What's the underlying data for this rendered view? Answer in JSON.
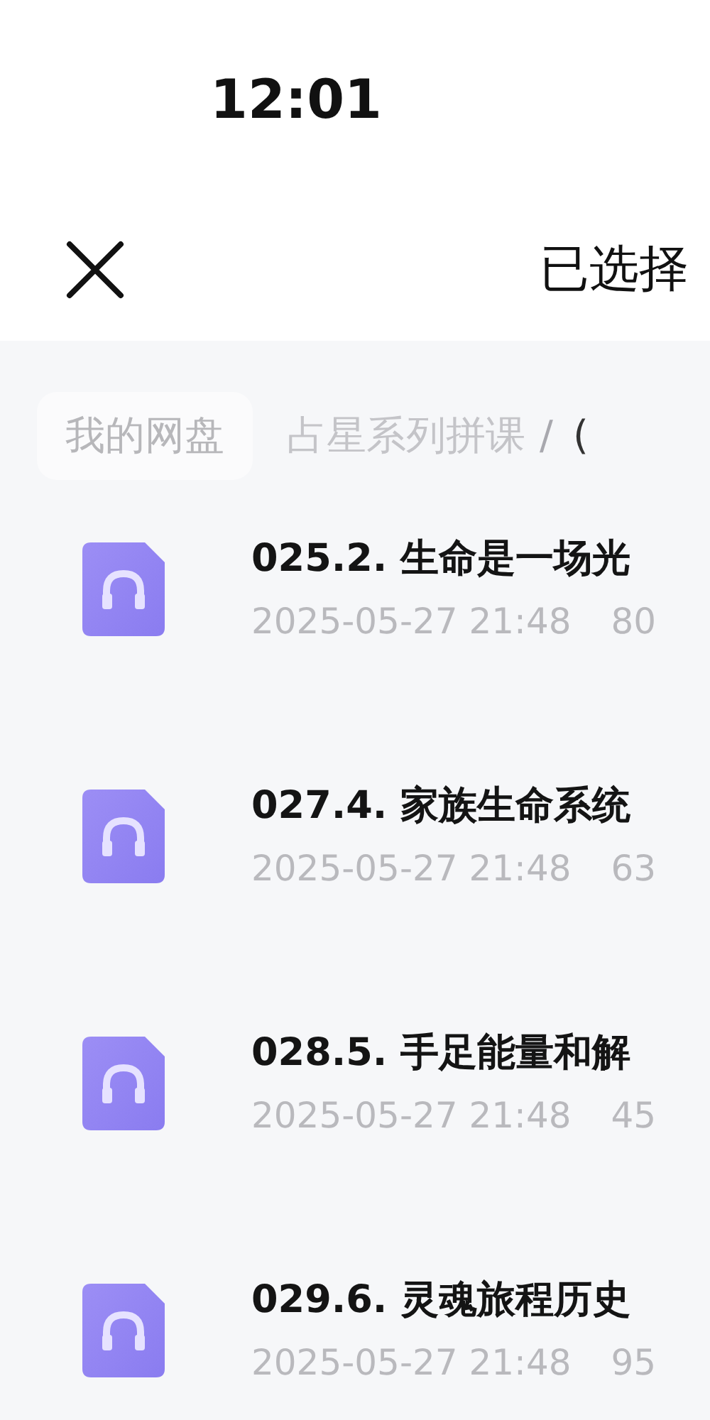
{
  "status_bar": {
    "time": "12:01"
  },
  "header": {
    "title": "已选择"
  },
  "breadcrumb": [
    {
      "label": "我的网盘",
      "kind": "root"
    },
    {
      "label": "占星系列拼课",
      "kind": "folder"
    },
    {
      "label": "/",
      "kind": "separator"
    },
    {
      "label": "(",
      "kind": "folder"
    }
  ],
  "files": [
    {
      "name": "025.2. 生命是一场光",
      "date": "2025-05-27 21:48",
      "size": "80"
    },
    {
      "name": "027.4. 家族生命系统",
      "date": "2025-05-27 21:48",
      "size": "63"
    },
    {
      "name": "028.5. 手足能量和解",
      "date": "2025-05-27 21:48",
      "size": "45"
    },
    {
      "name": "029.6. 灵魂旅程历史",
      "date": "2025-05-27 21:48",
      "size": "95"
    }
  ]
}
